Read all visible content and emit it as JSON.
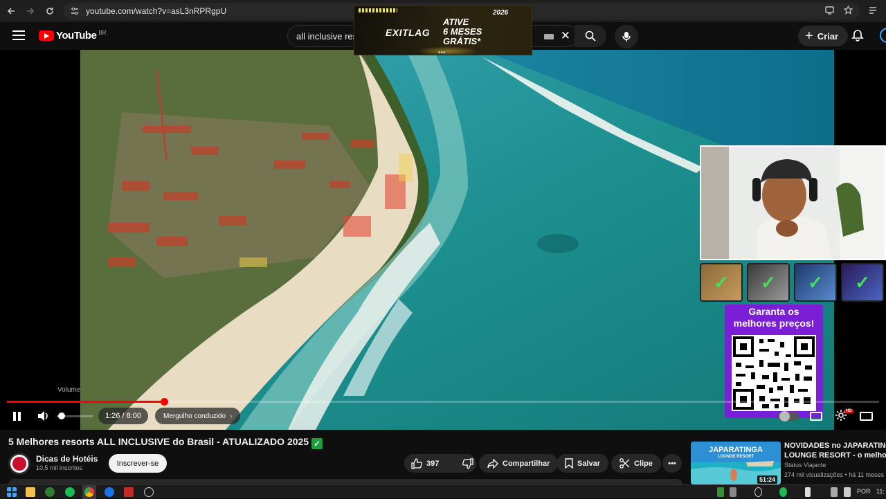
{
  "browser": {
    "url": "youtube.com/watch?v=asL3nRPRgpU",
    "back_icon": "arrow-left-icon",
    "forward_icon": "arrow-right-icon",
    "reload_icon": "reload-icon"
  },
  "header": {
    "logo_text": "YouTube",
    "country_code": "BR",
    "search_value": "all inclusive  res",
    "create_label": "Criar"
  },
  "ad": {
    "brand": "EXITLAG",
    "promo_line1": "ATIVE",
    "promo_line2": "6 MESES",
    "promo_line3": "GRÁTIS*",
    "tag": "2026",
    "dots": "•••"
  },
  "player": {
    "progress": 0.18,
    "volume": 0.05,
    "volume_tooltip": "Volume",
    "time": "1:26 / 8:00",
    "chapter": "Mergulho conduzido",
    "chapter_chevron": "›",
    "hd_badge": "HD"
  },
  "overlay": {
    "promo_line1": "Garanta os",
    "promo_line2": "melhores preços!",
    "card_check": "✓",
    "accent": "#7a1fd6"
  },
  "video_info": {
    "title": "5 Melhores resorts ALL INCLUSIVE do Brasil - ATUALIZADO 2025",
    "title_emoji": "✓",
    "channel": "Dicas de Hotéis",
    "subscribers": "10,5 mil inscritos",
    "subscribe_label": "Inscrever-se",
    "likes": "397",
    "share_label": "Compartilhar",
    "save_label": "Salvar",
    "clip_label": "Clipe",
    "more_label": "•••"
  },
  "recommended": {
    "title_line1": "NOVIDADES no JAPARATINGA",
    "title_line2": "LOUNGE RESORT - o melhor ...",
    "channel": "Status Viajante",
    "meta": "274 mil visualizações • há 11 meses",
    "duration": "51:24",
    "thumb_text": "JAPARATINGA",
    "thumb_sub": "LOUNGE RESORT"
  },
  "taskbar": {
    "language": "POR",
    "clock": "11:"
  }
}
